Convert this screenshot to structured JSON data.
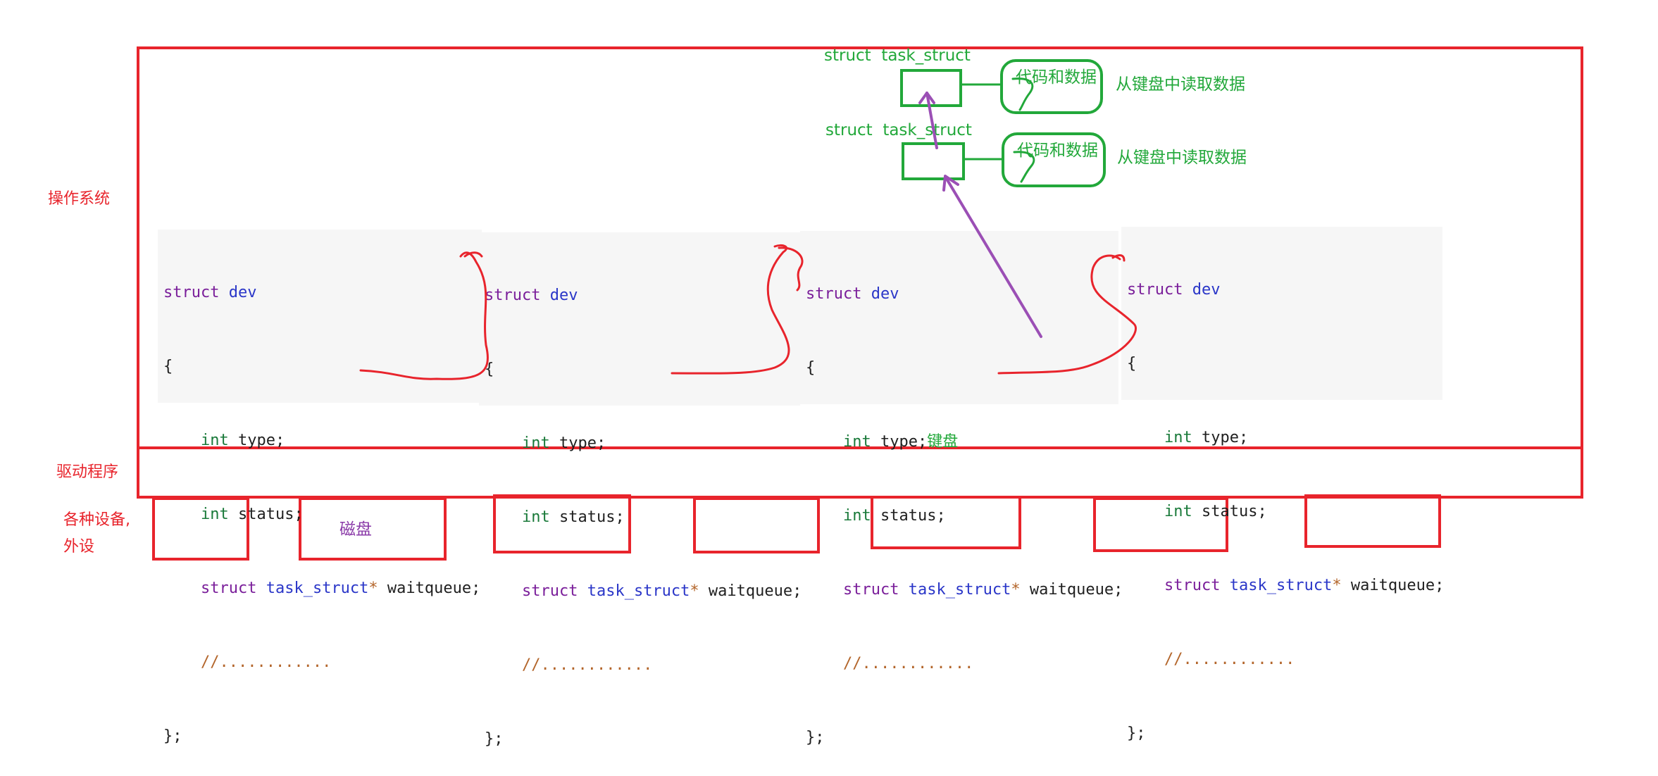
{
  "labels": {
    "os": "操作系统",
    "driver": "驱动程序",
    "devices_line1": "各种设备,",
    "devices_line2": "外设",
    "disk": "磁盘"
  },
  "task_structs": [
    {
      "title": "struct  task_struct",
      "box_text": "代码和数据",
      "note": "从键盘中读取数据"
    },
    {
      "title": "struct  task_struct",
      "box_text": "代码和数据",
      "note": "从键盘中读取数据"
    }
  ],
  "dev_blocks": [
    {
      "line1_kw": "struct",
      "line1_name": "dev",
      "open": "{",
      "type_kw": "int",
      "type_rest": " type;",
      "status_kw": "int",
      "status_rest": " status;",
      "wq_kw": "struct",
      "wq_type": "task_struct",
      "wq_star": "*",
      "wq_rest": " waitqueue;",
      "comment": "//............",
      "close": "};",
      "annotation": ""
    },
    {
      "line1_kw": "struct",
      "line1_name": "dev",
      "open": "{",
      "type_kw": "int",
      "type_rest": " type;",
      "status_kw": "int",
      "status_rest": " status;",
      "wq_kw": "struct",
      "wq_type": "task_struct",
      "wq_star": "*",
      "wq_rest": " waitqueue;",
      "comment": "//............",
      "close": "};",
      "annotation": ""
    },
    {
      "line1_kw": "struct",
      "line1_name": "dev",
      "open": "{",
      "type_kw": "int",
      "type_rest": " type;",
      "status_kw": "int",
      "status_rest": " status;",
      "wq_kw": "struct",
      "wq_type": "task_struct",
      "wq_star": "*",
      "wq_rest": " waitqueue;",
      "comment": "//............",
      "close": "};",
      "annotation": "键盘"
    },
    {
      "line1_kw": "struct",
      "line1_name": "dev",
      "open": "{",
      "type_kw": "int",
      "type_rest": " type;",
      "status_kw": "int",
      "status_rest": " status;",
      "wq_kw": "struct",
      "wq_type": "task_struct",
      "wq_star": "*",
      "wq_rest": " waitqueue;",
      "comment": "//............",
      "close": "};",
      "annotation": ""
    }
  ],
  "colors": {
    "red": "#e8242c",
    "green": "#22a83a",
    "purple": "#9b4fb5",
    "code_bg": "#f6f6f6",
    "keyword": "#7a1e9a",
    "type_name": "#2a36c8",
    "comment": "#b3652a"
  }
}
